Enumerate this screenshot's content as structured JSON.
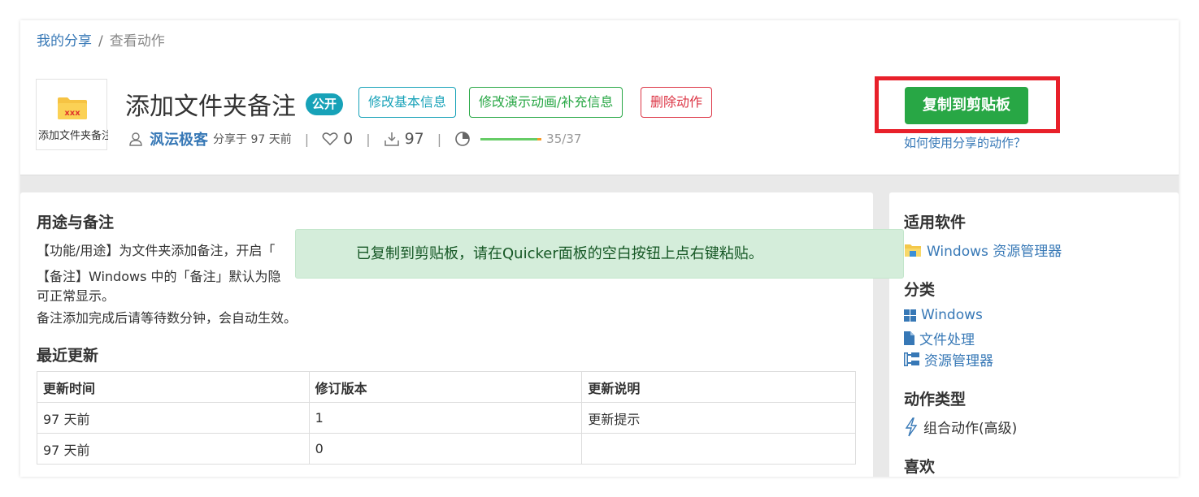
{
  "breadcrumb": {
    "parent": "我的分享",
    "separator": "/",
    "current": "查看动作"
  },
  "action": {
    "thumb_label": "添加文件夹备注",
    "thumb_icon_text": "xxx",
    "title": "添加文件夹备注",
    "visibility_badge": "公开",
    "buttons": {
      "edit_basic": "修改基本信息",
      "edit_demo": "修改演示动画/补充信息",
      "delete": "删除动作"
    },
    "author": "沨沄极客",
    "shared_time": "分享于 97 天前",
    "likes": "0",
    "downloads": "97",
    "progress_text": "35/37",
    "progress_fraction": 0.946
  },
  "copy": {
    "button_label": "复制到剪贴板",
    "howto_link": "如何使用分享的动作？"
  },
  "description": {
    "heading": "用途与备注",
    "lines": [
      "【功能/用途】为文件夹添加备注，开启「",
      "【备注】Windows 中的「备注」默认为隐",
      "可正常显示。",
      "备注添加完成后请等待数分钟，会自动生效。"
    ]
  },
  "updates": {
    "heading": "最近更新",
    "columns": [
      "更新时间",
      "修订版本",
      "更新说明"
    ],
    "rows": [
      [
        "97 天前",
        "1",
        "更新提示"
      ],
      [
        "97 天前",
        "0",
        ""
      ]
    ]
  },
  "sidebar": {
    "software_heading": "适用软件",
    "software": "Windows 资源管理器",
    "category_heading": "分类",
    "categories": [
      "Windows",
      "文件处理",
      "资源管理器"
    ],
    "type_heading": "动作类型",
    "type": "组合动作(高级)",
    "likes_heading": "喜欢"
  },
  "toast": {
    "message": "已复制到剪贴板，请在Quicker面板的空白按钮上点右键粘贴。"
  },
  "colors": {
    "link": "#3778b6",
    "success": "#28a745",
    "info": "#17a2b8",
    "danger": "#dc3545",
    "highlight": "#e8202a",
    "toast_bg": "#d4edda"
  }
}
